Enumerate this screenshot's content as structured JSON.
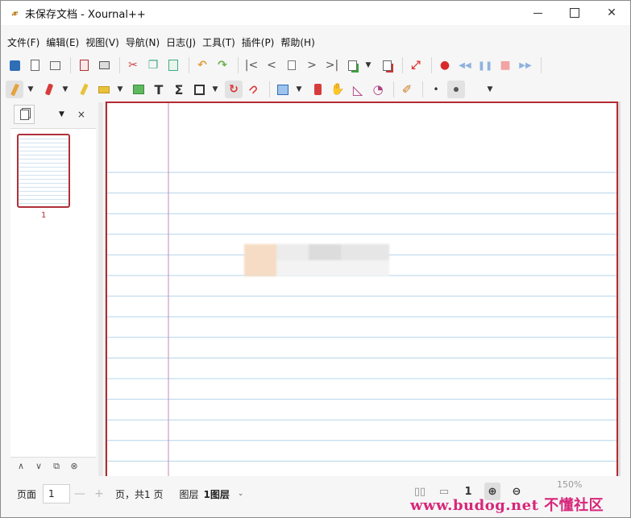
{
  "window": {
    "title": "未保存文档 - Xournal++",
    "controls": {
      "minimize": "—",
      "maximize": "☐",
      "close": "✕"
    }
  },
  "menu": [
    "文件(F)",
    "编辑(E)",
    "视图(V)",
    "导航(N)",
    "日志(J)",
    "工具(T)",
    "插件(P)",
    "帮助(H)"
  ],
  "toolbar_main": [
    {
      "name": "save-icon",
      "glyph": "💾"
    },
    {
      "name": "new-document-icon",
      "glyph": "🗋"
    },
    {
      "name": "open-folder-icon",
      "glyph": "🗁"
    },
    {
      "name": "export-pdf-icon",
      "glyph": "▤"
    },
    {
      "name": "print-icon",
      "glyph": "🖶"
    },
    {
      "name": "cut-icon",
      "glyph": "✂"
    },
    {
      "name": "copy-icon",
      "glyph": "❐"
    },
    {
      "name": "paste-icon",
      "glyph": "📋"
    },
    {
      "name": "undo-icon",
      "glyph": "↶"
    },
    {
      "name": "redo-icon",
      "glyph": "↷"
    },
    {
      "name": "first-page-icon",
      "glyph": "|<"
    },
    {
      "name": "previous-page-icon",
      "glyph": "<"
    },
    {
      "name": "goto-page-icon",
      "glyph": "▥"
    },
    {
      "name": "next-page-icon",
      "glyph": ">"
    },
    {
      "name": "last-page-icon",
      "glyph": ">|"
    },
    {
      "name": "insert-page-icon",
      "glyph": "⊞"
    },
    {
      "name": "delete-page-icon",
      "glyph": "⊟"
    },
    {
      "name": "fullscreen-icon",
      "glyph": "⤢"
    },
    {
      "name": "record-icon",
      "glyph": "●"
    },
    {
      "name": "rewind-icon",
      "glyph": "◀◀"
    },
    {
      "name": "pause-icon",
      "glyph": "❚❚"
    },
    {
      "name": "stop-icon",
      "glyph": "■"
    },
    {
      "name": "fast-forward-icon",
      "glyph": "▶▶"
    }
  ],
  "toolbar_tools": [
    {
      "name": "pen-icon",
      "glyph": "✎"
    },
    {
      "name": "eraser-icon",
      "glyph": "▰"
    },
    {
      "name": "highlighter-icon",
      "glyph": "🖍"
    },
    {
      "name": "text-select-icon",
      "glyph": "▭"
    },
    {
      "name": "image-icon",
      "glyph": "🖼"
    },
    {
      "name": "text-tool-icon",
      "glyph": "T"
    },
    {
      "name": "math-tex-icon",
      "glyph": "Σ"
    },
    {
      "name": "shape-rectangle-icon",
      "glyph": "□"
    },
    {
      "name": "shape-recognizer-icon",
      "glyph": "↻"
    },
    {
      "name": "ruler-magnet-icon",
      "glyph": "⊃"
    },
    {
      "name": "select-rectangle-icon",
      "glyph": "■"
    },
    {
      "name": "vertical-space-icon",
      "glyph": "⇕"
    },
    {
      "name": "hand-icon",
      "glyph": "✋"
    },
    {
      "name": "setsquare-icon",
      "glyph": "◺"
    },
    {
      "name": "compass-icon",
      "glyph": "◔"
    },
    {
      "name": "default-tool-icon",
      "glyph": "✐"
    },
    {
      "name": "thin-point-icon",
      "glyph": "•"
    },
    {
      "name": "medium-point-icon",
      "glyph": "●"
    }
  ],
  "sidebar": {
    "page_number": "1",
    "footer": [
      "∧",
      "∨",
      "⧉",
      "⊗"
    ],
    "close": "×"
  },
  "statusbar": {
    "page_label": "页面",
    "page_value": "1",
    "minus": "—",
    "plus": "+",
    "total": "页，共1 页",
    "layer_label": "图层",
    "layer_value": "1图层",
    "zoom": "150%",
    "watermark": "www.budog.net 不懂社区"
  },
  "colors": {
    "page_border": "#b52a32",
    "rule_line": "#b4d3ea",
    "margin_line": "#c48ab0",
    "accent_blue": "#2f6db5",
    "accent_red": "#d82a2a"
  }
}
